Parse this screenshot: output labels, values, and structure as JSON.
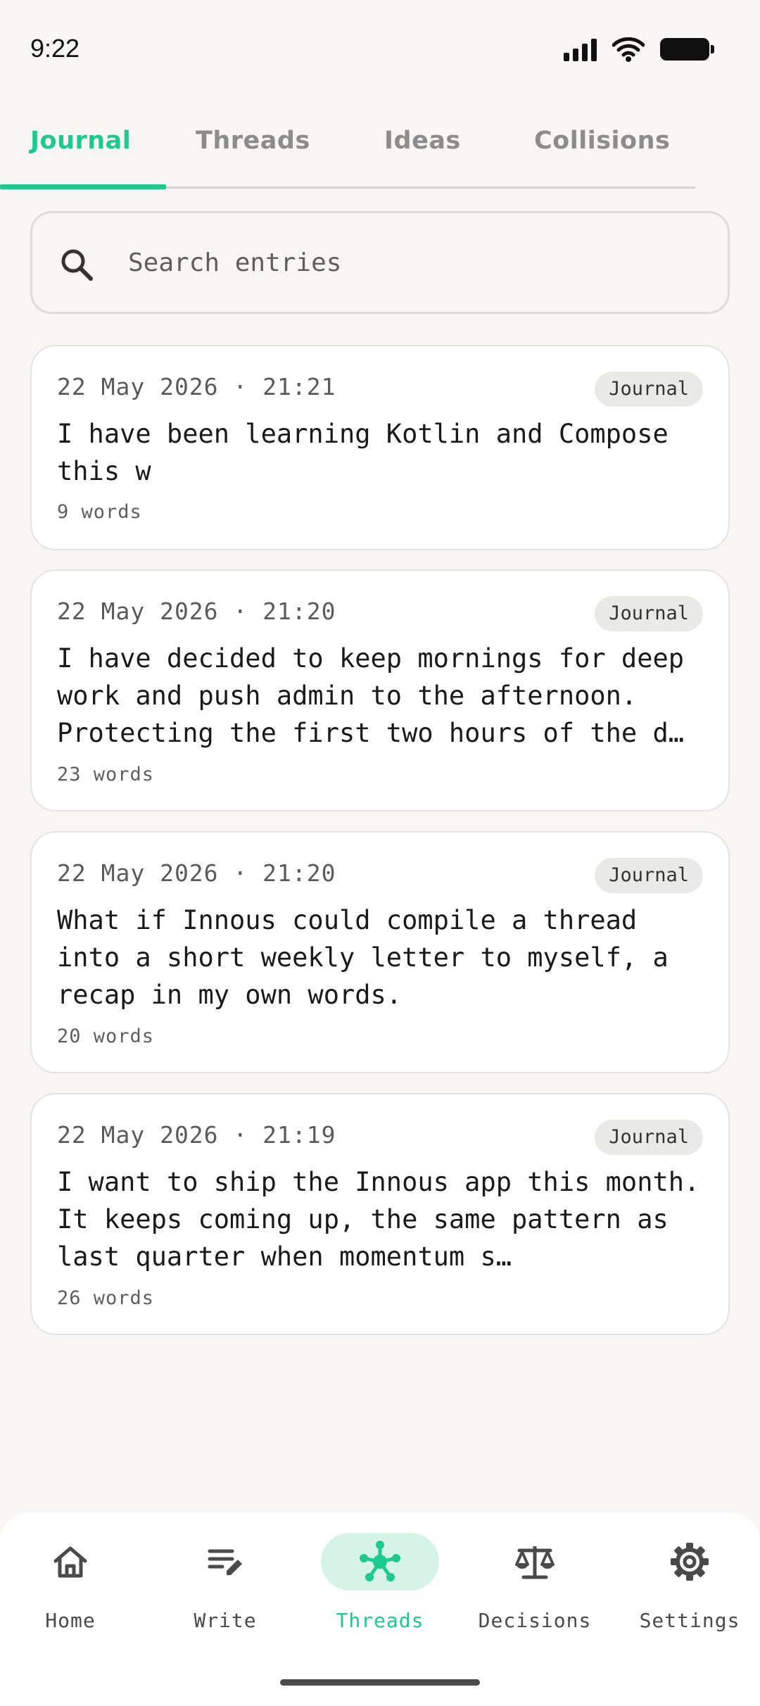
{
  "status": {
    "time": "9:22"
  },
  "tabs": [
    {
      "label": "Journal",
      "active": true
    },
    {
      "label": "Threads",
      "active": false
    },
    {
      "label": "Ideas",
      "active": false
    },
    {
      "label": "Collisions",
      "active": false
    }
  ],
  "search": {
    "placeholder": "Search entries",
    "value": ""
  },
  "entries": [
    {
      "date": "22 May 2026 · 21:21",
      "badge": "Journal",
      "text": "I have been learning Kotlin and Compose this w",
      "words": "9 words"
    },
    {
      "date": "22 May 2026 · 21:20",
      "badge": "Journal",
      "text": "I have decided to keep mornings for deep work and push admin to the afternoon. Protecting the first two hours of the d…",
      "words": "23 words"
    },
    {
      "date": "22 May 2026 · 21:20",
      "badge": "Journal",
      "text": "What if Innous could compile a thread into a short weekly letter to myself, a recap in my own words.",
      "words": "20 words"
    },
    {
      "date": "22 May 2026 · 21:19",
      "badge": "Journal",
      "text": "I want to ship the Innous app this month. It keeps coming up, the same pattern as last quarter when momentum s…",
      "words": "26 words"
    }
  ],
  "nav": [
    {
      "label": "Home",
      "icon": "home-icon",
      "active": false
    },
    {
      "label": "Write",
      "icon": "write-icon",
      "active": false
    },
    {
      "label": "Threads",
      "icon": "threads-icon",
      "active": true
    },
    {
      "label": "Decisions",
      "icon": "scale-icon",
      "active": false
    },
    {
      "label": "Settings",
      "icon": "gear-icon",
      "active": false
    }
  ],
  "colors": {
    "accent": "#1ec98f",
    "accent_soft": "#d5f4e7",
    "background": "#f7f6f4"
  }
}
